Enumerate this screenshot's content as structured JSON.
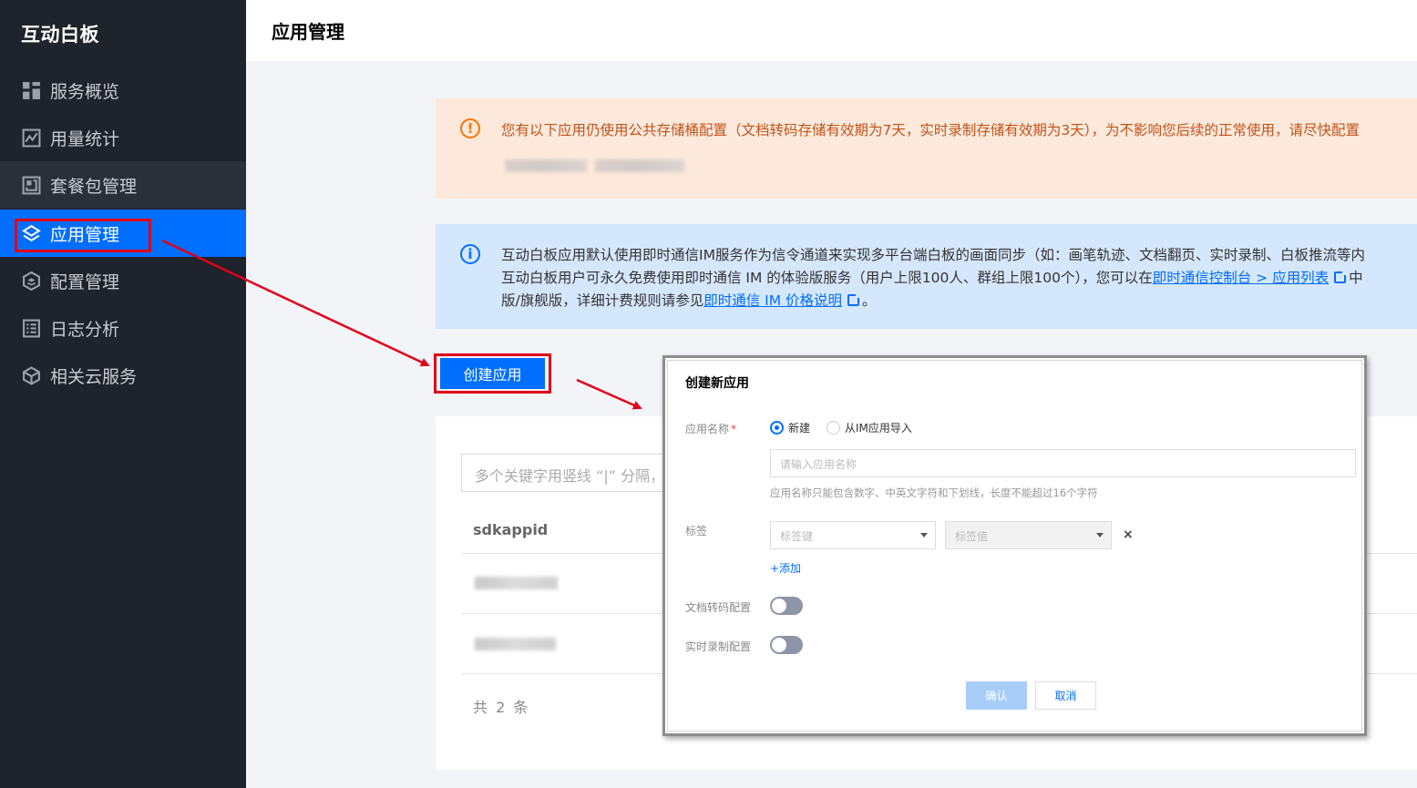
{
  "sidebar": {
    "brand": "互动白板",
    "items": [
      {
        "label": "服务概览",
        "icon": "grid-icon"
      },
      {
        "label": "用量统计",
        "icon": "chart-icon"
      },
      {
        "label": "套餐包管理",
        "icon": "package-icon"
      },
      {
        "label": "应用管理",
        "icon": "layers-icon"
      },
      {
        "label": "配置管理",
        "icon": "config-icon"
      },
      {
        "label": "日志分析",
        "icon": "log-icon"
      },
      {
        "label": "相关云服务",
        "icon": "cube-icon"
      }
    ]
  },
  "header": {
    "title": "应用管理"
  },
  "warning": {
    "icon": "!",
    "text": "您有以下应用仍使用公共存储桶配置（文档转码存储有效期为7天，实时录制存储有效期为3天），为不影响您后续的正常使用，请尽快配置"
  },
  "info": {
    "icon": "i",
    "line1": "互动白板应用默认使用即时通信IM服务作为信令通道来实现多平台端白板的画面同步（如：画笔轨迹、文档翻页、实时录制、白板推流等内",
    "line2_pre": "互动白板用户可永久免费使用即时通信 IM 的体验版服务（用户上限100人、群组上限100个），您可以在",
    "line2_link": "即时通信控制台 > 应用列表",
    "line2_post": "中",
    "line3_pre": "版/旗舰版，详细计费规则请参见",
    "line3_link": "即时通信 IM 价格说明",
    "line3_post": "。"
  },
  "create_button": "创建应用",
  "table": {
    "search_placeholder": "多个关键字用竖线 “|” 分隔，",
    "column": "sdkappid",
    "total": "共 2 条"
  },
  "dialog": {
    "title": "创建新应用",
    "name_label": "应用名称",
    "required_mark": "*",
    "radio_new": "新建",
    "radio_import": "从IM应用导入",
    "name_placeholder": "请输入应用名称",
    "name_hint": "应用名称只能包含数字、中英文字符和下划线，长度不能超过16个字符",
    "tag_label": "标签",
    "tag_key_placeholder": "标签键",
    "tag_value_placeholder": "标签值",
    "remove": "×",
    "add": "+添加",
    "doc_label": "文档转码配置",
    "record_label": "实时录制配置",
    "ok": "确认",
    "cancel": "取消"
  },
  "colors": {
    "accent": "#006eff",
    "sidebar": "#1f232b",
    "highlight": "#e0001b"
  }
}
